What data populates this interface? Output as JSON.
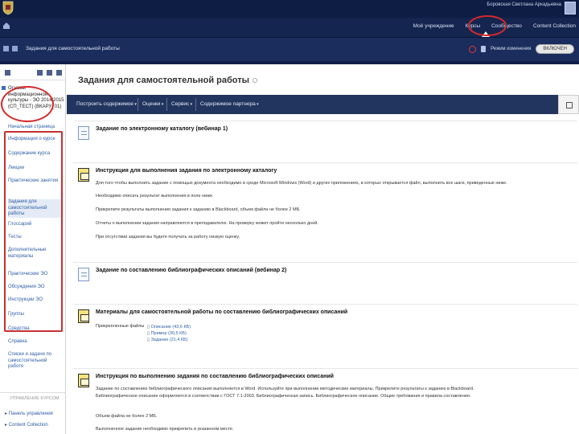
{
  "header": {
    "title": "",
    "user_name": "Боровская Светлана Аркадьевна"
  },
  "nav": {
    "items": [
      "Моё учреждение",
      "Курсы",
      "Сообщество",
      "Content Collection"
    ],
    "active": "Курсы"
  },
  "crumb": {
    "label": "Задания для самостоятельной работы",
    "edit_mode_label": "Режим изменения",
    "edit_toggle": "ВКЛЮЧЕН"
  },
  "sidebar": {
    "course_title": "Основы информационной культуры - ЭО 2014/2015 (СП_ТЕСТ) (ВКАРУ_01)",
    "items": [
      {
        "label": "Начальная страница",
        "active": false
      },
      {
        "label": "Информация о курсе",
        "active": false
      },
      {
        "label": "Содержание курса",
        "active": false
      },
      {
        "label": "Лекции",
        "active": false
      },
      {
        "label": "Практические занятия",
        "active": false
      },
      {
        "label": "Задания для самостоятельной работы",
        "active": true
      },
      {
        "label": "Глоссарий",
        "active": false
      },
      {
        "label": "Тесты",
        "active": false
      },
      {
        "label": "Дополнительные материалы",
        "active": false
      },
      {
        "label": "Практические ЭО",
        "active": false
      },
      {
        "label": "Обсуждения ЭО",
        "active": false
      },
      {
        "label": "Инструкции ЭО",
        "active": false
      },
      {
        "label": "Группы",
        "active": false
      },
      {
        "label": "Средства",
        "active": false
      },
      {
        "label": "Справка",
        "active": false
      },
      {
        "label": "Списки и задачи по самостоятельной работе",
        "active": false
      }
    ],
    "bottom_label": "УПРАВЛЕНИЕ КУРСОМ",
    "bottom_links": [
      "Панель управления",
      "Content Collection"
    ]
  },
  "main": {
    "page_title": "Задания для самостоятельной работы",
    "toolbar": [
      "Построить содержимое",
      "Оценки",
      "Сервис",
      "Содержимое партнера"
    ],
    "items": [
      {
        "title": "Задание по электронному каталогу (вебинар 1)",
        "icon": "doc-icon",
        "lines": []
      },
      {
        "title": "Инструкция для выполнения задания по электронному каталогу",
        "icon": "instructions-icon",
        "lines": [
          "Для того чтобы выполнить задание с помощью документа необходимо в среде Microsoft Windows (Word) и других приложениях, в которых открывается файл, выполнить все шаги, приведенные ниже.",
          "Необходимо описать результат выполнения в поле ниже.",
          "Прикрепите результаты выполнения задания к заданию в Blackboard, объем файла не более 2 МБ.",
          "Отчеты о выполнении задания направляются в преподавателю. На проверку может пройти несколько дней.",
          "При отсутствии задания вы будете получать за работу низкую оценку."
        ]
      },
      {
        "title": "Задание по составлению библиографических описаний (вебинар 2)",
        "icon": "doc-icon",
        "lines": []
      },
      {
        "title": "Материалы для самостоятельной работы по составлению библиографических описаний",
        "icon": "instructions-icon",
        "lines": [],
        "files_label": "Прикрепленные файлы",
        "files": [
          "Описание (43,6 КБ)",
          "Пример (30,5 КБ)",
          "Задание (21,4 КБ)"
        ]
      },
      {
        "title": "Инструкция по выполнению задания по составлению библиографических описаний",
        "icon": "instructions-icon",
        "lines": [
          "Задание по составлению библиографического описания выполняется в Word. Используйте при выполнении методические материалы. Прикрепите результаты к заданию в Blackboard.",
          "Библиографическое описание оформляется в соответствии с ГОСТ 7.1-2003. Библиографическая запись. Библиографическое описание. Общие требования и правила составления.",
          "Объем файла не более 2 МБ.",
          "Выполненное задание необходимо прикрепить в указанном месте."
        ]
      }
    ]
  }
}
